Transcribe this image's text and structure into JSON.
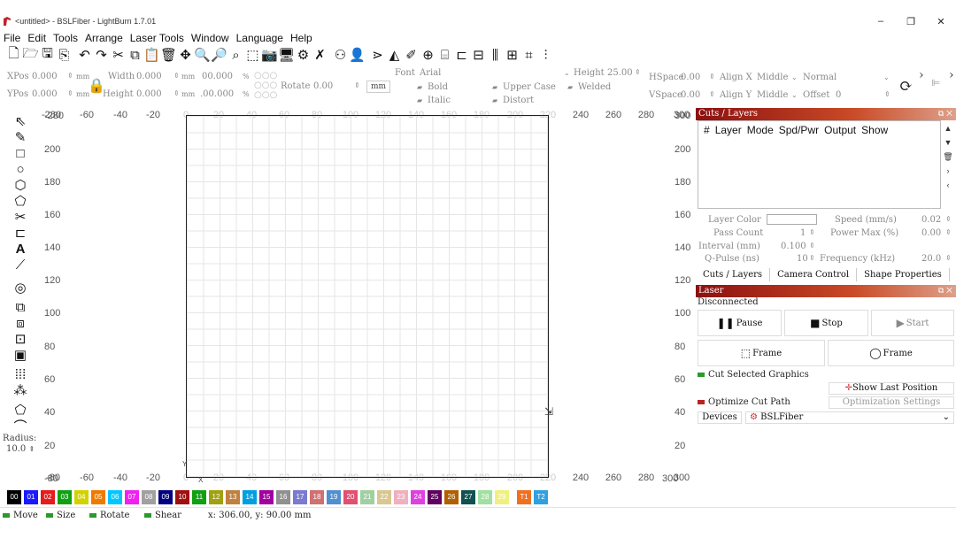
{
  "window": {
    "title": "<untitled> - BSLFiber - LightBurn 1.7.01",
    "minimize": "–",
    "restore": "❐",
    "close": "✕"
  },
  "menu": [
    "File",
    "Edit",
    "Tools",
    "Arrange",
    "Laser Tools",
    "Window",
    "Language",
    "Help"
  ],
  "toolbar_icons": [
    "new-file",
    "open-folder",
    "save",
    "save-as",
    "undo",
    "redo",
    "cut",
    "copy",
    "paste",
    "delete",
    "move-to-origin",
    "zoom-in",
    "zoom-out",
    "zoom-frame",
    "frame-select",
    "camera",
    "monitor",
    "settings",
    "tools",
    "group",
    "user",
    "mirror-h",
    "mirror-v",
    "pen",
    "target",
    "layout",
    "align",
    "distribute",
    "spacing",
    "ruler"
  ],
  "props": {
    "xpos_label": "XPos",
    "xpos": "0.000",
    "ypos_label": "YPos",
    "ypos": "0.000",
    "unit": "mm",
    "width_label": "Width",
    "width": "0.000",
    "height_label": "Height",
    "height": "0.000",
    "pct1": "00.000",
    "pct2": ".00.000",
    "pct_unit": "%",
    "rotate_label": "Rotate",
    "rotate": "0.00",
    "mm_btn": "mm",
    "font_label": "Font",
    "font": "Arial",
    "fheight_label": "Height",
    "fheight": "25.00",
    "bold": "Bold",
    "italic": "Italic",
    "upper_case": "Upper Case",
    "distort": "Distort",
    "welded": "Welded",
    "hspace_label": "HSpace",
    "hspace": "0.00",
    "vspace_label": "VSpace",
    "vspace": "0.00",
    "alignx_label": "Align X",
    "alignx": "Middle",
    "aligny_label": "Align Y",
    "aligny": "Middle",
    "normal": "Normal",
    "offset_label": "Offset",
    "offset": "0"
  },
  "ruler": {
    "top": [
      "-280",
      "-60",
      "-40",
      "-20",
      "0",
      "20",
      "40",
      "60",
      "80",
      "100",
      "120",
      "140",
      "160",
      "180",
      "200",
      "220",
      "240",
      "260",
      "280",
      "300"
    ],
    "left": [
      "-280",
      "200",
      "180",
      "160",
      "140",
      "120",
      "100",
      "80",
      "60",
      "40",
      "20",
      "0",
      "-80"
    ],
    "right": [
      "300",
      "200",
      "180",
      "160",
      "140",
      "120",
      "100",
      "80",
      "60",
      "40",
      "20",
      "300"
    ]
  },
  "radius": {
    "label": "Radius:",
    "value": "10.0"
  },
  "cuts": {
    "title": "Cuts / Layers",
    "cols": [
      "#",
      "Layer",
      "Mode",
      "Spd/Pwr",
      "Output",
      "Show"
    ],
    "layer_color": "Layer Color",
    "speed_label": "Speed (mm/s)",
    "speed": "0.02",
    "pass_label": "Pass Count",
    "pass": "1",
    "power_label": "Power Max (%)",
    "power": "0.00",
    "interval_label": "Interval (mm)",
    "interval": "0.100",
    "qpulse_label": "Q-Pulse (ns)",
    "qpulse": "10",
    "freq_label": "Frequency (kHz)",
    "freq": "20.0"
  },
  "tabs": [
    "Cuts / Layers",
    "Camera Control",
    "Shape Properties"
  ],
  "laser": {
    "title": "Laser",
    "status": "Disconnected",
    "pause": "Pause",
    "stop": "Stop",
    "start": "Start",
    "frame1": "Frame",
    "frame2": "Frame",
    "cut_selected": "Cut Selected Graphics",
    "show_last": "Show Last Position",
    "optimize": "Optimize Cut Path",
    "opt_settings": "Optimization Settings",
    "devices": "Devices",
    "device": "BSLFiber"
  },
  "palette": [
    {
      "id": "00",
      "c": "#000000"
    },
    {
      "id": "01",
      "c": "#1a1aff"
    },
    {
      "id": "02",
      "c": "#e81a1a"
    },
    {
      "id": "03",
      "c": "#12a012"
    },
    {
      "id": "04",
      "c": "#d2d200"
    },
    {
      "id": "05",
      "c": "#f07a00"
    },
    {
      "id": "06",
      "c": "#00c8ff"
    },
    {
      "id": "07",
      "c": "#f020f0"
    },
    {
      "id": "08",
      "c": "#a0a0a0"
    },
    {
      "id": "09",
      "c": "#000080"
    },
    {
      "id": "10",
      "c": "#a01010"
    },
    {
      "id": "11",
      "c": "#10a010"
    },
    {
      "id": "12",
      "c": "#a0a010"
    },
    {
      "id": "13",
      "c": "#c08040"
    },
    {
      "id": "14",
      "c": "#00a0e0"
    },
    {
      "id": "15",
      "c": "#a000a0"
    },
    {
      "id": "16",
      "c": "#909090"
    },
    {
      "id": "17",
      "c": "#7a7ad0"
    },
    {
      "id": "18",
      "c": "#d07070"
    },
    {
      "id": "19",
      "c": "#5090d0"
    },
    {
      "id": "20",
      "c": "#e05070"
    },
    {
      "id": "21",
      "c": "#a0d0a0"
    },
    {
      "id": "22",
      "c": "#d8c890"
    },
    {
      "id": "23",
      "c": "#f0b0c0"
    },
    {
      "id": "24",
      "c": "#e040e0"
    },
    {
      "id": "25",
      "c": "#600060"
    },
    {
      "id": "26",
      "c": "#b06000"
    },
    {
      "id": "27",
      "c": "#105050"
    },
    {
      "id": "28",
      "c": "#a0e0a0"
    },
    {
      "id": "29",
      "c": "#f0f080"
    },
    {
      "id": "T1",
      "c": "#f07020"
    },
    {
      "id": "T2",
      "c": "#30a0e0"
    }
  ],
  "status": {
    "move": "Move",
    "size": "Size",
    "rotate": "Rotate",
    "shear": "Shear",
    "coords": "x: 306.00, y: 90.00 mm"
  }
}
